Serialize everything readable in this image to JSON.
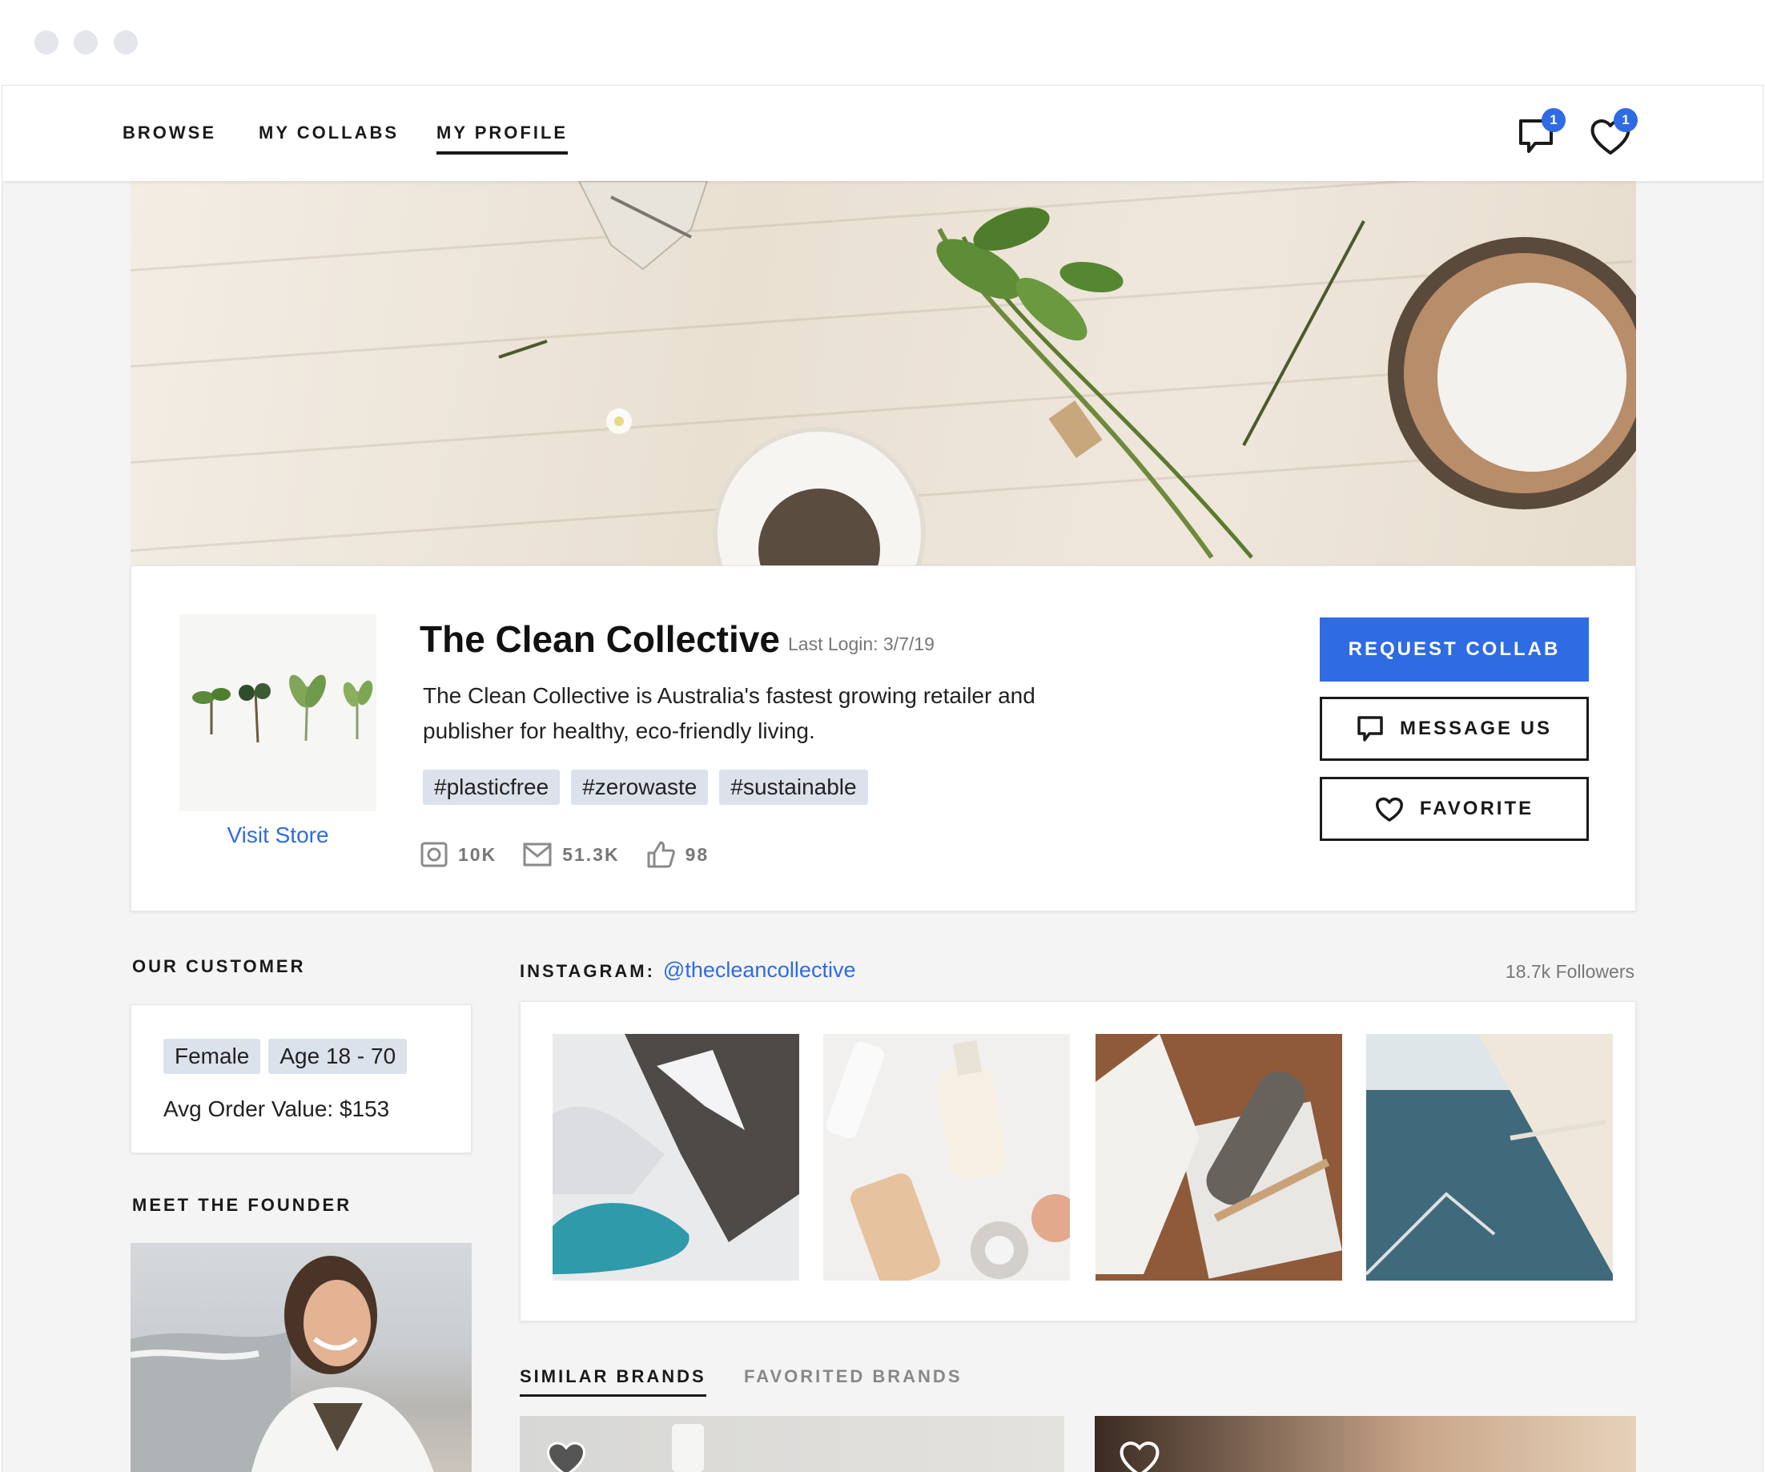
{
  "nav": {
    "items": [
      {
        "label": "BROWSE"
      },
      {
        "label": "MY COLLABS"
      },
      {
        "label": "MY PROFILE"
      }
    ],
    "messages_badge": "1",
    "favorites_badge": "1"
  },
  "profile": {
    "name": "The Clean Collective",
    "last_login": "Last Login: 3/7/19",
    "description": "The Clean Collective is Australia's fastest growing retailer and publisher for healthy, eco-friendly living.",
    "tags": [
      "#plasticfree",
      "#zerowaste",
      "#sustainable"
    ],
    "visit_store": "Visit Store",
    "stats": {
      "instagram": "10K",
      "email": "51.3K",
      "likes": "98"
    },
    "buttons": {
      "request": "REQUEST COLLAB",
      "message": "MESSAGE US",
      "favorite": "FAVORITE"
    }
  },
  "customer": {
    "title": "OUR CUSTOMER",
    "gender": "Female",
    "age": "Age 18 - 70",
    "aov": "Avg Order Value: $153"
  },
  "founder": {
    "title": "MEET THE FOUNDER"
  },
  "instagram": {
    "label": "INSTAGRAM:",
    "handle": "@thecleancollective",
    "followers": "18.7k Followers"
  },
  "tabs": {
    "similar": "SIMILAR BRANDS",
    "favorited": "FAVORITED BRANDS"
  },
  "colors": {
    "accent": "#2f6be2",
    "tag_bg": "#dbe2ec",
    "page_bg": "#f4f4f4"
  }
}
